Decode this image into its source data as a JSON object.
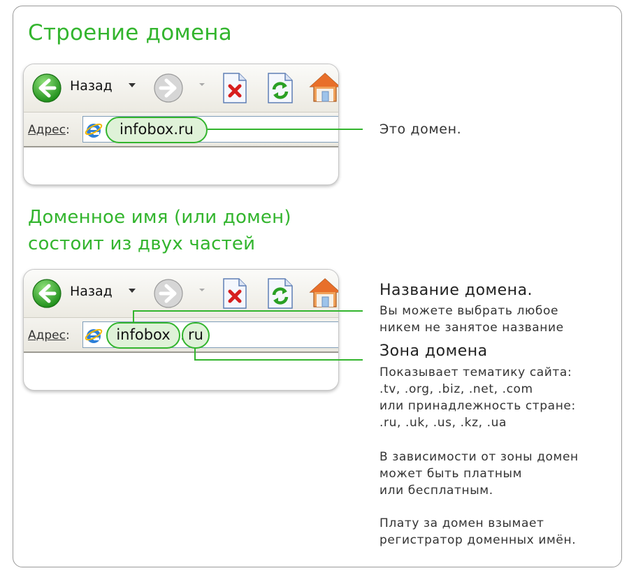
{
  "title_structure": "Строение домена",
  "title_parts_line1": "Доменное имя (или домен)",
  "title_parts_line2": "состоит из двух частей",
  "browser": {
    "back_label": "Назад",
    "address_label": "Адрес",
    "address_suffix": ":",
    "domain_full": "infobox.ru",
    "domain_name": "infobox",
    "domain_zone": "ru"
  },
  "annotations": {
    "this_is_domain": "Это домен.",
    "name_heading": "Название домена.",
    "name_desc": "Вы можете выбрать любое\nникем не занятое название",
    "zone_heading": "Зона домена",
    "zone_desc": "Показывает тематику сайта:\n.tv, .org, .biz, .net, .com\nили принадлежность стране:\n.ru, .uk, .us, .kz, .ua",
    "paid_note": "В зависимости от зоны домен\nможет быть платным\nили бесплатным.",
    "registrar_note": "Плату за домен взымает\nрегистратор доменных имён."
  },
  "colors": {
    "accent": "#33b52e",
    "pill_fill": "#dff2d8"
  },
  "icons": [
    "back-arrow-icon",
    "forward-arrow-icon",
    "stop-page-icon",
    "refresh-page-icon",
    "home-icon",
    "ie-logo-icon"
  ]
}
